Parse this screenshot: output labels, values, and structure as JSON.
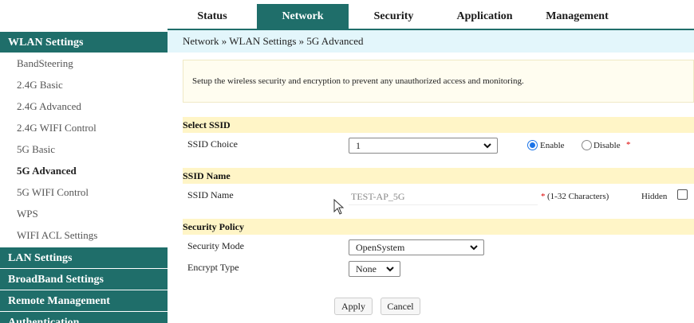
{
  "nav": {
    "tabs": [
      {
        "label": "Status"
      },
      {
        "label": "Network"
      },
      {
        "label": "Security"
      },
      {
        "label": "Application"
      },
      {
        "label": "Management"
      }
    ],
    "active_tab": "Network"
  },
  "sidebar": {
    "wlan_header": "WLAN Settings",
    "wlan_items": [
      {
        "label": "BandSteering"
      },
      {
        "label": "2.4G Basic"
      },
      {
        "label": "2.4G Advanced"
      },
      {
        "label": "2.4G WIFI Control"
      },
      {
        "label": "5G Basic"
      },
      {
        "label": "5G Advanced"
      },
      {
        "label": "5G WIFI Control"
      },
      {
        "label": "WPS"
      },
      {
        "label": "WIFI ACL Settings"
      }
    ],
    "active_item": "5G Advanced",
    "lan_header": "LAN Settings",
    "broadband_header": "BroadBand Settings",
    "remote_header": "Remote Management",
    "auth_header": "Authentication"
  },
  "breadcrumb": "Network » WLAN Settings » 5G Advanced",
  "description": "Setup the wireless security and encryption to prevent any unauthorized access and monitoring.",
  "select_ssid": {
    "section_title": "Select SSID",
    "label": "SSID Choice",
    "value": "1",
    "enable_label": "Enable",
    "disable_label": "Disable",
    "required_mark": "*",
    "enabled": true
  },
  "ssid_name": {
    "section_title": "SSID Name",
    "label": "SSID Name",
    "value": "TEST-AP_5G",
    "required_mark": "*",
    "hint": "(1-32 Characters)",
    "hidden_label": "Hidden",
    "hidden_checked": false
  },
  "security_policy": {
    "section_title": "Security Policy",
    "mode_label": "Security Mode",
    "mode_value": "OpenSystem",
    "encrypt_label": "Encrypt Type",
    "encrypt_value": "None"
  },
  "buttons": {
    "apply": "Apply",
    "cancel": "Cancel"
  },
  "colors": {
    "primary": "#1f6e6a",
    "section_bar": "#fff5c7",
    "breadcrumb_bg": "#e3f6fb"
  }
}
